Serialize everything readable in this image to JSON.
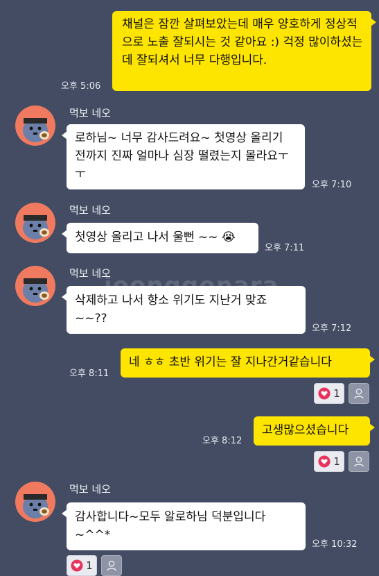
{
  "watermark": "joonggonara",
  "messages": [
    {
      "type": "mine",
      "text": "채널은 잠깐 살펴보았는데 매우 양호하게 정상적으로 노출 잘되시는 것 같아요 :) 걱정 많이하셨는데 잘되셔서 너무 다행입니다.",
      "time": "오후 5:06"
    },
    {
      "type": "theirs",
      "sender": "먹보 네오",
      "text": "로하님~ 너무 감사드려요~ 첫영상 올리기 전까지 진짜 얼마나 심장 떨렸는지 몰라요ㅜㅜ",
      "time": "오후 7:10"
    },
    {
      "type": "theirs",
      "sender": "먹보 네오",
      "text": "첫영상 올리고 나서 울뻔 ~~",
      "emoji": "😭",
      "time": "오후 7:11"
    },
    {
      "type": "theirs",
      "sender": "먹보 네오",
      "text": "삭제하고 나서 항소 위기도 지난거 맞죠 ~~??",
      "time": "오후 7:12"
    },
    {
      "type": "mine",
      "text": "네 ㅎㅎ 초반 위기는 잘 지나간거같습니다",
      "time": "오후 8:11",
      "reaction_count": "1"
    },
    {
      "type": "mine",
      "text": "고생많으셨습니다",
      "time": "오후 8:12",
      "reaction_count": "1"
    },
    {
      "type": "theirs",
      "sender": "먹보 네오",
      "text": "감사합니다~모두 알로하님 덕분입니다 ~^^*",
      "time": "오후 10:32",
      "reaction_count": "1"
    }
  ],
  "colors": {
    "background": "#434c63",
    "mine_bubble": "#fee500",
    "theirs_bubble": "#ffffff",
    "avatar_bg": "#f07a5f",
    "heart": "#e8335c"
  }
}
